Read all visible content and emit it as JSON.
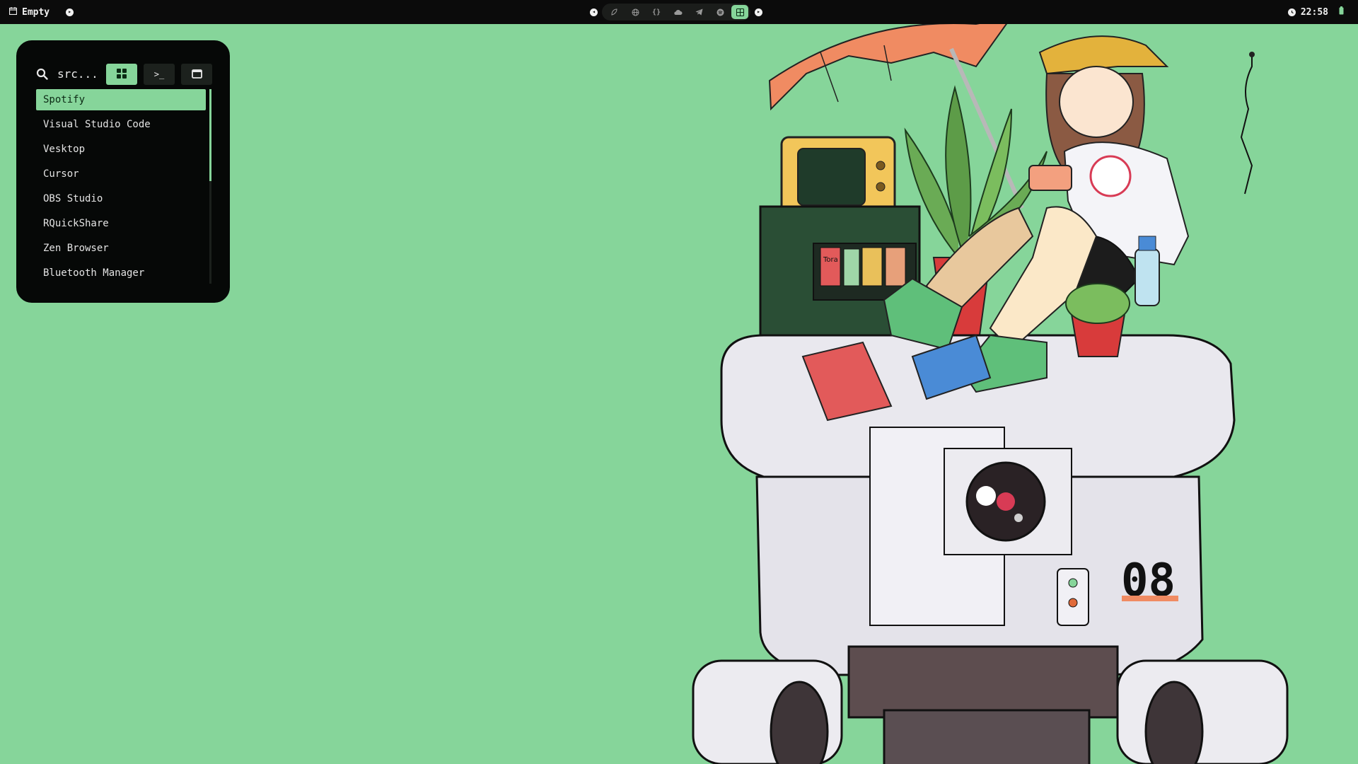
{
  "topbar": {
    "workspace_icon": "calendar-icon",
    "workspace_label": "Empty",
    "play_icon": "play-icon",
    "prev_icon": "chevron-left-icon",
    "next_icon": "chevron-right-icon",
    "tray_icons": [
      "leaf-icon",
      "globe-icon",
      "code-braces-icon",
      "cloud-icon",
      "telegram-icon",
      "spotify-icon",
      "launcher-grid-icon"
    ],
    "active_tray_index": 6,
    "clock_icon": "clock-icon",
    "time": "22:58",
    "battery_icon": "battery-icon"
  },
  "launcher": {
    "search_text": "src...",
    "modes": [
      {
        "name": "apps",
        "icon": "grid-icon",
        "active": true
      },
      {
        "name": "terminal",
        "icon": "terminal-icon",
        "glyph": ">_",
        "active": false
      },
      {
        "name": "windows",
        "icon": "window-icon",
        "active": false
      }
    ],
    "apps": [
      "Spotify",
      "Visual Studio Code",
      "Vesktop",
      "Cursor",
      "OBS Studio",
      "RQuickShare",
      "Zen Browser",
      "Bluetooth Manager"
    ],
    "selected_index": 0
  },
  "wallpaper": {
    "robot_number": "08",
    "can_text": "Tora"
  },
  "colors": {
    "accent": "#86d59a",
    "bar_bg": "#0b0b0b",
    "panel_bg": "#060807",
    "text": "#e4e4e4"
  }
}
